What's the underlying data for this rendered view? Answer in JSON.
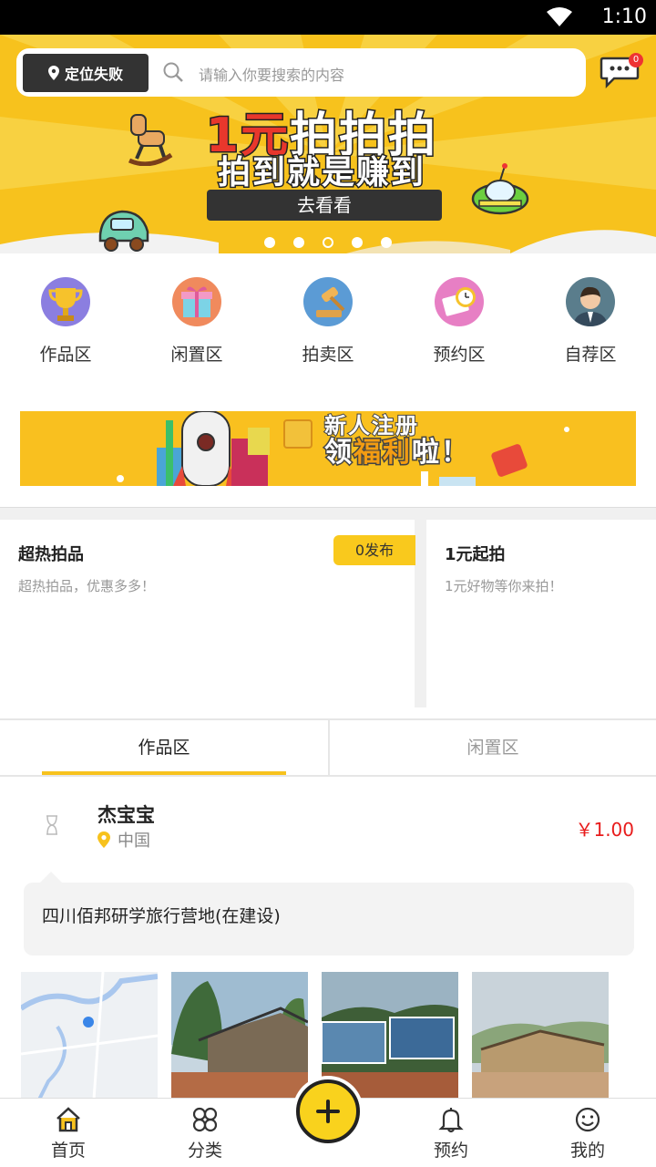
{
  "status_bar": {
    "time": "1:10"
  },
  "search": {
    "location_label": "定位失败",
    "placeholder": "请输入你要搜索的内容",
    "message_count": "0"
  },
  "banner": {
    "title_accent": "1元",
    "title_rest": "拍拍拍",
    "subtitle": "拍到就是赚到",
    "cta": "去看看",
    "slide_count": 5,
    "active_slide": 3
  },
  "categories": [
    {
      "label": "作品区",
      "icon": "trophy-icon",
      "color": "#8b7ee0"
    },
    {
      "label": "闲置区",
      "icon": "gift-icon",
      "color": "#f08a5d"
    },
    {
      "label": "拍卖区",
      "icon": "gavel-icon",
      "color": "#5b9bd5"
    },
    {
      "label": "预约区",
      "icon": "clock-icon",
      "color": "#e77fc4"
    },
    {
      "label": "自荐区",
      "icon": "person-icon",
      "color": "#5a7d8c"
    }
  ],
  "newuser_banner": {
    "line1": "新人注册",
    "line2_pre": "领",
    "line2_accent": "福利",
    "line2_post": "啦！"
  },
  "hot_cards": {
    "left": {
      "title": "超热拍品",
      "desc": "超热拍品，优惠多多！",
      "badge": "0发布"
    },
    "right": {
      "title": "1元起拍",
      "desc": "1元好物等你来拍！"
    }
  },
  "tabs": [
    {
      "label": "作品区",
      "active": true
    },
    {
      "label": "闲置区",
      "active": false
    }
  ],
  "post": {
    "username": "杰宝宝",
    "location": "中国",
    "price": "￥1.00",
    "content": "四川佰邦研学旅行营地(在建设)"
  },
  "bottom_nav": [
    {
      "label": "首页",
      "icon": "home-icon"
    },
    {
      "label": "分类",
      "icon": "category-icon"
    },
    {
      "label": "预约",
      "icon": "bell-icon"
    },
    {
      "label": "我的",
      "icon": "smiley-icon"
    }
  ],
  "colors": {
    "brand_yellow": "#f7c21d",
    "price_red": "#e81b1b"
  }
}
